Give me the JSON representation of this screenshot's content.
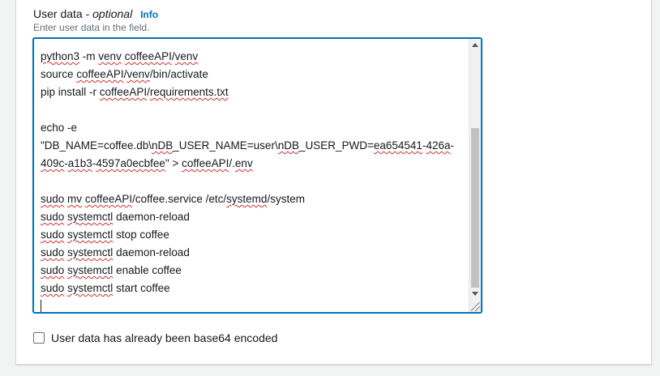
{
  "user_data": {
    "label": "User data - ",
    "optional": "optional",
    "info_link": "Info",
    "hint": "Enter user data in the field.",
    "lines": [
      [
        {
          "t": "python3",
          "sq": true
        },
        {
          "t": " -m "
        },
        {
          "t": "venv",
          "sq": true
        },
        {
          "t": " "
        },
        {
          "t": "coffeeAPI",
          "sq": true
        },
        {
          "t": "/"
        },
        {
          "t": "venv",
          "sq": true
        }
      ],
      [
        {
          "t": "source "
        },
        {
          "t": "coffeeAPI",
          "sq": true
        },
        {
          "t": "/"
        },
        {
          "t": "venv",
          "sq": true
        },
        {
          "t": "/bin/activate"
        }
      ],
      [
        {
          "t": "pip install -r "
        },
        {
          "t": "coffeeAPI",
          "sq": true
        },
        {
          "t": "/"
        },
        {
          "t": "requirements.txt",
          "sq": true
        }
      ],
      [],
      [
        {
          "t": "echo -e"
        }
      ],
      [
        {
          "t": "\"DB_NAME=coffee.db\\"
        },
        {
          "t": "nDB",
          "sq": true
        },
        {
          "t": "_USER_NAME=user\\"
        },
        {
          "t": "nDB",
          "sq": true
        },
        {
          "t": "_USER_PWD="
        },
        {
          "t": "ea654541",
          "sq": true
        },
        {
          "t": "-"
        },
        {
          "t": "426a",
          "sq": true
        },
        {
          "t": "-"
        }
      ],
      [
        {
          "t": "409c",
          "sq": true
        },
        {
          "t": "-"
        },
        {
          "t": "a1b3",
          "sq": true
        },
        {
          "t": "-"
        },
        {
          "t": "4597a0ecbfee",
          "sq": true
        },
        {
          "t": "\" > "
        },
        {
          "t": "coffeeAPI",
          "sq": true
        },
        {
          "t": "/."
        },
        {
          "t": "env",
          "sq": true
        }
      ],
      [],
      [
        {
          "t": "sudo",
          "sq": true
        },
        {
          "t": " "
        },
        {
          "t": "mv",
          "sq": true
        },
        {
          "t": " "
        },
        {
          "t": "coffeeAPI",
          "sq": true
        },
        {
          "t": "/coffee.service /etc/"
        },
        {
          "t": "systemd",
          "sq": true
        },
        {
          "t": "/system"
        }
      ],
      [
        {
          "t": "sudo",
          "sq": true
        },
        {
          "t": " "
        },
        {
          "t": "systemctl",
          "sq": true
        },
        {
          "t": " daemon-reload"
        }
      ],
      [
        {
          "t": "sudo",
          "sq": true
        },
        {
          "t": " "
        },
        {
          "t": "systemctl",
          "sq": true
        },
        {
          "t": " stop coffee"
        }
      ],
      [
        {
          "t": "sudo",
          "sq": true
        },
        {
          "t": " "
        },
        {
          "t": "systemctl",
          "sq": true
        },
        {
          "t": " daemon-reload"
        }
      ],
      [
        {
          "t": "sudo",
          "sq": true
        },
        {
          "t": " "
        },
        {
          "t": "systemctl",
          "sq": true
        },
        {
          "t": " enable coffee"
        }
      ],
      [
        {
          "t": "sudo",
          "sq": true
        },
        {
          "t": " "
        },
        {
          "t": "systemctl",
          "sq": true
        },
        {
          "t": " start coffee"
        }
      ]
    ]
  },
  "base64_checkbox": {
    "label": "User data has already been base64 encoded",
    "checked": false
  },
  "colors": {
    "accent": "#0073bb",
    "spellcheck": "#d32f2f"
  }
}
